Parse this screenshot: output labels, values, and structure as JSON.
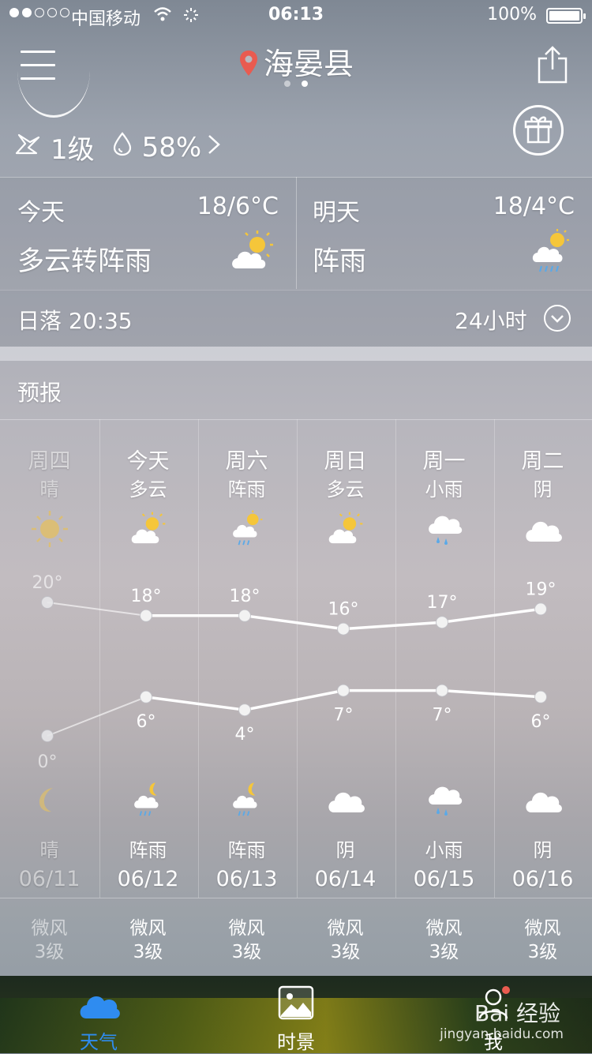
{
  "status_bar": {
    "carrier": "中国移动",
    "time": "06:13",
    "battery": "100%"
  },
  "header": {
    "location": "海晏县",
    "page_count": 2,
    "active_page": 2
  },
  "current": {
    "wind": "1级",
    "humidity": "58%"
  },
  "today": {
    "label": "今天",
    "temp": "18/6°C",
    "condition": "多云转阵雨",
    "icon": "partly-cloudy-icon"
  },
  "tomorrow": {
    "label": "明天",
    "temp": "18/4°C",
    "condition": "阵雨",
    "icon": "shower-icon"
  },
  "sun": {
    "label": "日落 20:35",
    "hours_button": "24小时"
  },
  "forecast": {
    "title": "预报",
    "days": [
      {
        "week": "周四",
        "day_cond": "晴",
        "day_icon": "sun-icon",
        "high": "20°",
        "low": "0°",
        "night_icon": "moon-icon",
        "night_cond": "晴",
        "date": "06/11",
        "wind": "微风",
        "level": "3级",
        "past": true
      },
      {
        "week": "今天",
        "day_cond": "多云",
        "day_icon": "partly-cloudy-icon",
        "high": "18°",
        "low": "6°",
        "night_icon": "night-shower-icon",
        "night_cond": "阵雨",
        "date": "06/12",
        "wind": "微风",
        "level": "3级",
        "past": false
      },
      {
        "week": "周六",
        "day_cond": "阵雨",
        "day_icon": "shower-icon",
        "high": "18°",
        "low": "4°",
        "night_icon": "night-shower-icon",
        "night_cond": "阵雨",
        "date": "06/13",
        "wind": "微风",
        "level": "3级",
        "past": false
      },
      {
        "week": "周日",
        "day_cond": "多云",
        "day_icon": "partly-cloudy-icon",
        "high": "16°",
        "low": "7°",
        "night_icon": "cloud-icon",
        "night_cond": "阴",
        "date": "06/14",
        "wind": "微风",
        "level": "3级",
        "past": false
      },
      {
        "week": "周一",
        "day_cond": "小雨",
        "day_icon": "rain-icon",
        "high": "17°",
        "low": "7°",
        "night_icon": "rain-icon",
        "night_cond": "小雨",
        "date": "06/15",
        "wind": "微风",
        "level": "3级",
        "past": false
      },
      {
        "week": "周二",
        "day_cond": "阴",
        "day_icon": "cloud-icon",
        "high": "19°",
        "low": "6°",
        "night_icon": "cloud-icon",
        "night_cond": "阴",
        "date": "06/16",
        "wind": "微风",
        "level": "3级",
        "past": false
      }
    ]
  },
  "chart_data": {
    "type": "line",
    "x": [
      "06/11",
      "06/12",
      "06/13",
      "06/14",
      "06/15",
      "06/16"
    ],
    "series": [
      {
        "values": [
          20,
          18,
          18,
          16,
          17,
          19
        ]
      },
      {
        "values": [
          0,
          6,
          4,
          7,
          7,
          6
        ]
      }
    ]
  },
  "tabbar": {
    "tabs": [
      {
        "label": "天气",
        "icon": "cloud-tab-icon",
        "active": true
      },
      {
        "label": "时景",
        "icon": "photo-tab-icon",
        "active": false
      },
      {
        "label": "我",
        "icon": "profile-tab-icon",
        "active": false
      }
    ]
  },
  "watermark": {
    "brand": "Bai 经验",
    "url": "jingyan.baidu.com"
  },
  "colors": {
    "accent": "#2f8cf0",
    "pin": "#e95b50",
    "sun": "#f5c63a"
  }
}
